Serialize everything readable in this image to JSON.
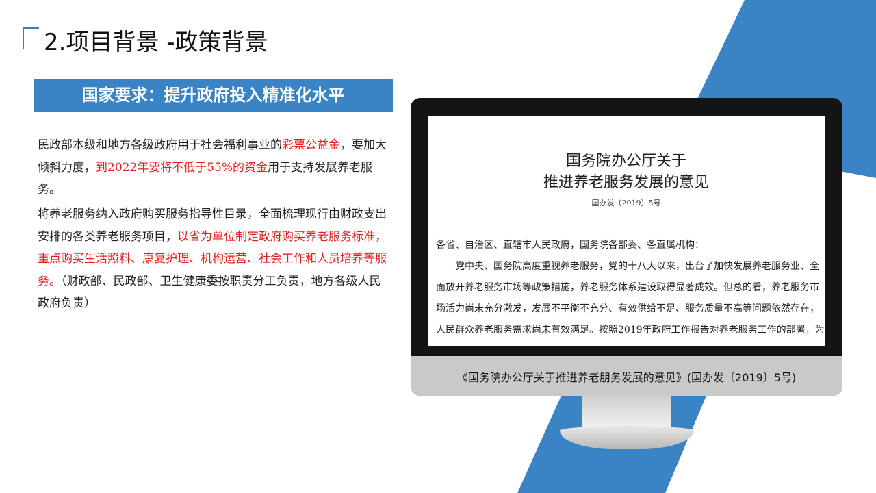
{
  "header": {
    "title": "2.项目背景 -政策背景"
  },
  "banner": {
    "text": "国家要求：提升政府投入精准化水平"
  },
  "paragraph1": {
    "part1": "民政部本级和地方各级政府用于社会福利事业的",
    "part2_red": "彩票公益金",
    "part3": "，要加大倾斜力度，",
    "part4_red": "到2022年要将不低于55%的资金",
    "part5": "用于支持发展养老服务。"
  },
  "paragraph2": {
    "part1": "将养老服务纳入政府购买服务指导性目录，全面梳理现行由财政支出安排的各类养老服务项目，",
    "part2_red": "以省为单位制定政府购买养老服务标准，重点购买生活照料、康复护理、机构运营、社会工作和人员培养等服务。",
    "part3": "（财政部、民政部、卫生健康委按职责分工负责，地方各级人民政府负责）"
  },
  "document": {
    "title_line1": "国务院办公厅关于",
    "title_line2": "推进养老服务发展的意见",
    "number": "国办发〔2019〕5号",
    "body_lines": [
      "各省、自治区、直辖市人民政府，国务院各部委、各直属机构：",
      "　　党中央、国务院高度重视养老服务，党的十八大以来，出台了加快发展养老服务业、全",
      "面放开养老服务市场等政策措施，养老服务体系建设取得显著成效。但总的看，养老服务市",
      "场活力尚未充分激发，发展不平衡不充分、有效供给不足、服务质量不高等问题依然存在，",
      "人民群众养老服务需求尚未有效满足。按照2019年政府工作报告对养老服务工作的部署，为"
    ]
  },
  "caption": "《国务院办公厅关于推进养老朋务发展的意见》(国办发〔2019〕5号)",
  "colors": {
    "accent": "#3a83c5",
    "highlight": "#e02020"
  }
}
